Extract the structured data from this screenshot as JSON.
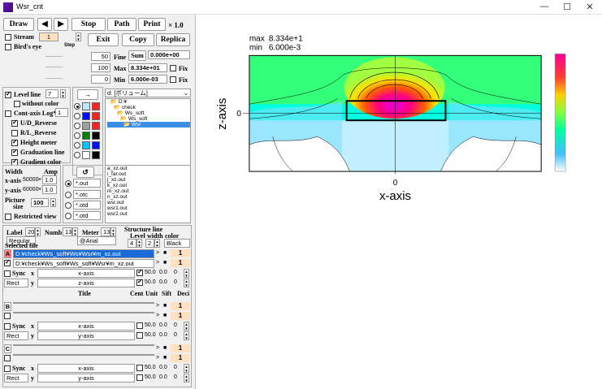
{
  "window": {
    "title": "Wsr_cnt",
    "min": "—",
    "max": "☐",
    "close": "✕"
  },
  "toolbar": {
    "draw": "Draw",
    "prev": "◀",
    "next": "▶",
    "stop": "Stop",
    "path": "Path",
    "print": "Print",
    "zoom": "× 1.0",
    "exit": "Exit",
    "copy": "Copy",
    "replica": "Replica"
  },
  "stream": {
    "label": "Stream",
    "value": "1",
    "step": "Step",
    "birds_eye": "Bird's eye"
  },
  "fine": {
    "v1": "50",
    "v2": "100",
    "v3": "0",
    "fine": "Fine",
    "sum": "Sum",
    "sum_val": "0.000e+00",
    "max": "Max",
    "max_val": "8.334e+01",
    "min": "Min",
    "min_val": "6.000e-03",
    "fix": "Fix"
  },
  "levels": {
    "level_line": "Level line",
    "level_val": "7",
    "without_color": "without color",
    "cont_log": "Cont-axis Log*",
    "cont_val": "1",
    "ud": "U/D_Reverse",
    "rl": "R/L_Reverse",
    "height": "Height meter",
    "grad_line": "Graduation line",
    "grad_color": "Gradient color"
  },
  "palette": {
    "arrow": "→",
    "colors": [
      "#bfe6ff",
      "#ff2020",
      "#0010ff",
      "#ff2020",
      "#a0a0a0",
      "#ff2020",
      "#008000",
      "#000000",
      "#00c0ff",
      "#0010ff",
      "#ffffff",
      "#000000"
    ]
  },
  "drive": {
    "label": "d: [ボリューム]"
  },
  "dirs": [
    "D:¥",
    "check",
    "Ws_soft",
    "Ws_soft",
    "Wsr"
  ],
  "size": {
    "width": "Width",
    "amp": "Amp",
    "xaxis": "x-axis",
    "xval": "50000",
    "xamp": "1.0",
    "yaxis": "y-axis",
    "yval": "60000",
    "yamp": "1.0",
    "picture": "Picture",
    "size": "size",
    "pic_val": "100",
    "restricted": "Restricted view",
    "refresh": "↺"
  },
  "ext": [
    "*.out",
    "*.otc",
    "*.otd",
    "*.otd"
  ],
  "files": [
    "a_xz.out",
    "i_far.out",
    "j_xz.out",
    "k_xz.out",
    "m_xz.out",
    "n_xz.out",
    "wsr.out",
    "wsr1.out",
    "wsr2.out"
  ],
  "structure": {
    "label": "Label",
    "label_val": "20",
    "numb": "Numb",
    "numb_val": "13",
    "meter": "Meter",
    "meter_val": "13",
    "struct": "Structure line",
    "level": "Level",
    "width": "width",
    "color": "color",
    "lv": "4",
    "wv": "2",
    "cv": "Black",
    "font1": "Regular",
    "font2": "@Arial",
    "selected": "Selected file"
  },
  "files_sel": {
    "a_path": "D:¥check¥Ws_soft¥Ws¥Wsr¥m_xz.out",
    "b_path": "D:¥check¥Ws_soft¥Ws_soft¥Wsr¥m_xz.out",
    "one": "1",
    "dot": "■",
    "gt": ">",
    "minus": "-"
  },
  "rows": {
    "sync": "Sync",
    "x": "x",
    "y": "y",
    "rect": "Rect",
    "xaxis": "x-axis",
    "zaxis": "z-axis",
    "yaxis": "y-axis",
    "cent": "50.0",
    "unit": "0.0",
    "sift": "0",
    "title": "Title",
    "hcent": "Cent",
    "hunit": "Unit",
    "hsift": "Sift",
    "hdeci": "Deci"
  },
  "sections": {
    "a": "A",
    "b": "B",
    "c": "C"
  },
  "plot": {
    "max_label": "max",
    "max_val": "8.334e+1",
    "min_label": "min",
    "min_val": "6.000e-3",
    "xlabel": "x-axis",
    "ylabel": "z-axis",
    "x0": "0",
    "y0": "0"
  }
}
